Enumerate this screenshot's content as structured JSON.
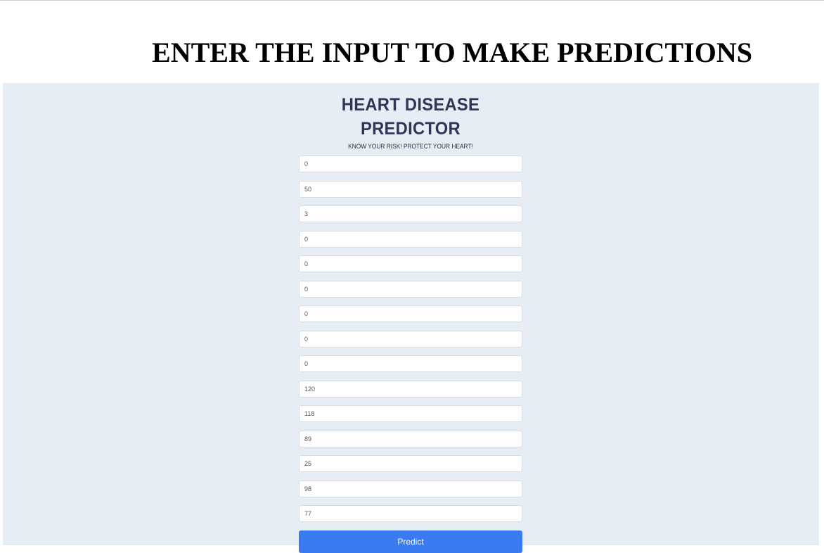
{
  "page_title": "ENTER THE INPUT TO MAKE PREDICTIONS",
  "form": {
    "brand_title": "HEART DISEASE PREDICTOR",
    "tagline": "KNOW YOUR RISK! PROTECT YOUR HEART!",
    "fields": [
      "0",
      "50",
      "3",
      "0",
      "0",
      "0",
      "0",
      "0",
      "0",
      "120",
      "118",
      "89",
      "25",
      "98",
      "77"
    ],
    "submit_label": "Predict"
  },
  "colors": {
    "panel_background": "#e6edf4",
    "brand_text": "#333556",
    "button_background": "#3a7bf2",
    "button_text": "#ffffff"
  }
}
